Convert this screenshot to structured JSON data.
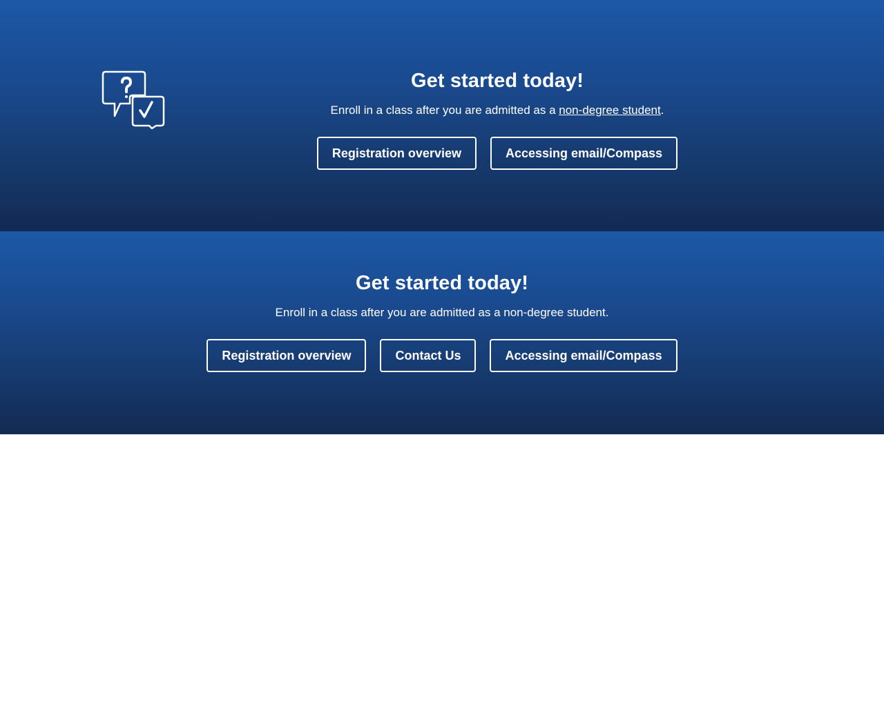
{
  "section_one": {
    "title": "Get started today!",
    "lede_prefix": "Enroll in a class after you are admitted as a ",
    "lede_link": "non-degree student",
    "lede_suffix": ".",
    "buttons": [
      {
        "label": "Registration overview"
      },
      {
        "label": "Accessing email/Compass"
      }
    ],
    "icon": "question-answer-chat-icon"
  },
  "section_two": {
    "title": "Get started today!",
    "lede": "Enroll in a class after you are admitted as a non-degree student.",
    "buttons": [
      {
        "label": "Registration overview"
      },
      {
        "label": "Contact Us"
      },
      {
        "label": "Accessing email/Compass"
      }
    ]
  },
  "colors": {
    "gradient_top": "#1c59a7",
    "gradient_bottom": "#132a52",
    "text": "#ffffff",
    "page_background": "#ffffff"
  }
}
